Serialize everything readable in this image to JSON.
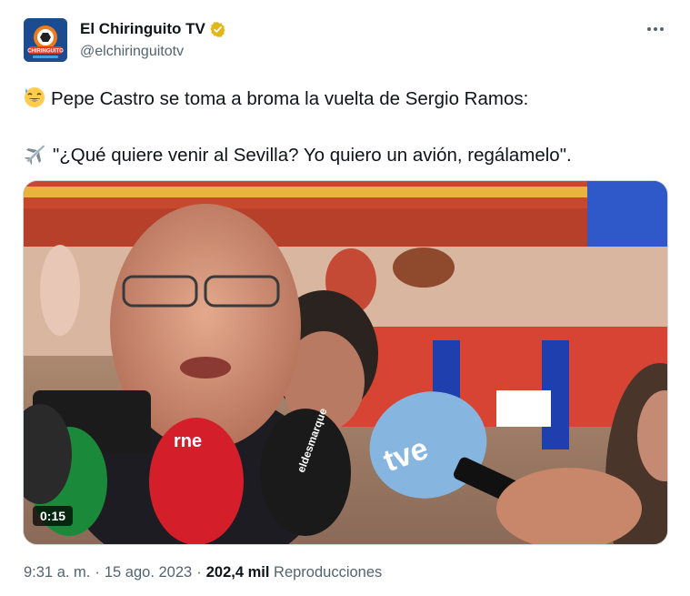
{
  "author": {
    "display_name": "El Chiringuito TV",
    "handle": "@elchiringuitotv",
    "avatar_text": "CHIRINGUITO",
    "verified": true,
    "verified_color": "#E2B719"
  },
  "menu": {
    "icon": "more-horizontal-icon"
  },
  "tweet": {
    "line1_emoji": "sweat-smile-emoji",
    "line1": "Pepe Castro se toma a broma la vuelta de Sergio Ramos:",
    "line2_emoji": "airplane-emoji",
    "line2": "\"¿Qué quiere venir al Sevilla? Yo quiero un avión, regálamelo\"."
  },
  "media": {
    "type": "video",
    "duration": "0:15",
    "mic_labels": [
      "rne",
      "tve",
      "eldesmarque"
    ]
  },
  "meta": {
    "time": "9:31 a. m.",
    "separator": "·",
    "date": "15 ago. 2023",
    "views_count": "202,4 mil",
    "views_label": "Reproducciones"
  },
  "colors": {
    "text_primary": "#0f1419",
    "text_secondary": "#536471",
    "border": "#cfd9de"
  }
}
